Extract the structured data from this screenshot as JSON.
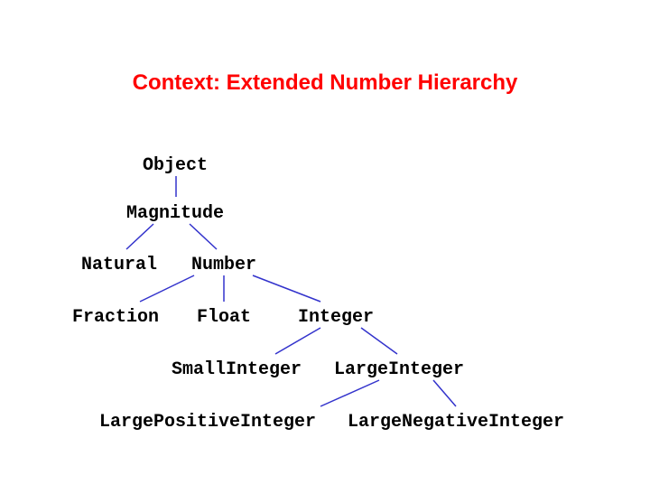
{
  "title": "Context: Extended Number Hierarchy",
  "nodes": {
    "object": "Object",
    "magnitude": "Magnitude",
    "natural": "Natural",
    "number": "Number",
    "fraction": "Fraction",
    "float": "Float",
    "integer": "Integer",
    "smallinteger": "SmallInteger",
    "largeinteger": "LargeInteger",
    "largepositiveinteger": "LargePositiveInteger",
    "largenegativeinteger": "LargeNegativeInteger"
  }
}
